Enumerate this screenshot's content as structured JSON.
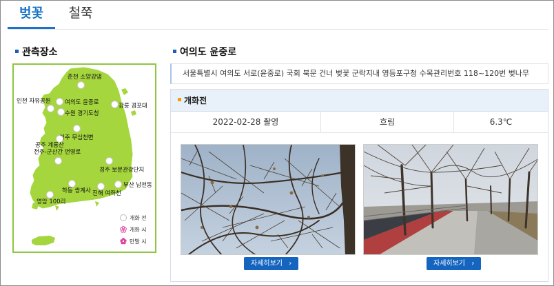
{
  "tabs": [
    {
      "label": "벚꽃",
      "active": true
    },
    {
      "label": "철쭉",
      "active": false
    }
  ],
  "left_section": {
    "title": "관측장소"
  },
  "map": {
    "locations": [
      {
        "name": "춘천 소양강댐"
      },
      {
        "name": "인천 자유공원"
      },
      {
        "name": "여의도 윤중로"
      },
      {
        "name": "수원 경기도청"
      },
      {
        "name": "강릉 경포대"
      },
      {
        "name": "청주 무심천변"
      },
      {
        "name": "공주 계룡산"
      },
      {
        "name": "전주-군산간 번영로"
      },
      {
        "name": "경주 보문관광단지"
      },
      {
        "name": "부산 남천동"
      },
      {
        "name": "하동 쌍계사"
      },
      {
        "name": "진해 여좌천"
      },
      {
        "name": "영암 100리"
      }
    ],
    "legend": [
      {
        "label": "개화 전",
        "marker": "white-circle"
      },
      {
        "label": "개화 시",
        "marker": "pink-flower-outline"
      },
      {
        "label": "만발 시",
        "marker": "pink-flower-filled"
      }
    ],
    "colors": {
      "land": "#a5d63d",
      "border": "#8dc63f",
      "pin": "#ffffff",
      "flower": "#e040a0"
    }
  },
  "detail": {
    "title": "여의도 윤중로",
    "address": "서울특별시 여의도 서로(윤중로) 국회 북문 건너 벚꽃 군락지내 영등포구청 수목관리번호 118~120번 벚나무",
    "status": "개화전",
    "date": "2022-02-28 촬영",
    "weather": "흐림",
    "temperature": "6.3℃",
    "photos": [
      {
        "button_label": "자세히보기",
        "icon": "chevron-right-icon"
      },
      {
        "button_label": "자세히보기",
        "icon": "chevron-right-icon"
      }
    ]
  }
}
